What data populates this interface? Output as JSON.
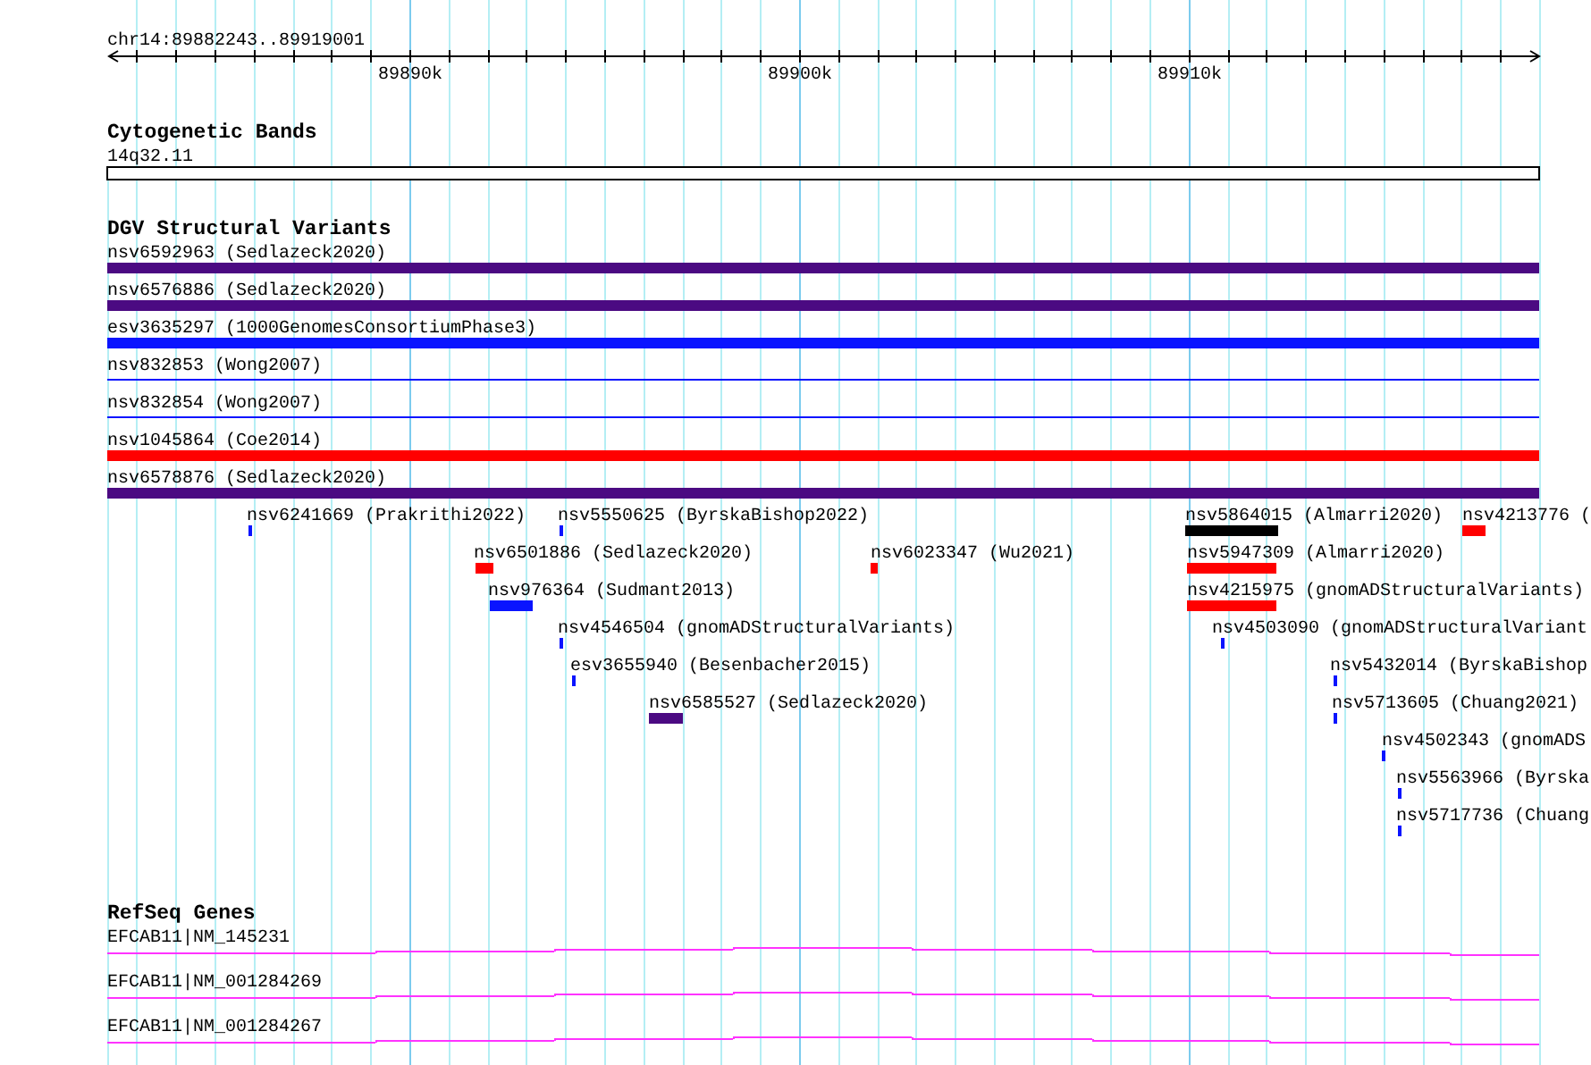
{
  "ruler": {
    "location": "chr14:89882243..89919001",
    "tick_labels": [
      "89890k",
      "89900k",
      "89910k"
    ]
  },
  "cytogenetic_bands": {
    "title": "Cytogenetic Bands",
    "band": "14q32.11"
  },
  "dgv_structural_variants": {
    "title": "DGV Structural Variants",
    "features": [
      {
        "label": "nsv6592963 (Sedlazeck2020)",
        "color": "#4b0a82",
        "kind": "bar"
      },
      {
        "label": "nsv6576886 (Sedlazeck2020)",
        "color": "#4b0a82",
        "kind": "bar"
      },
      {
        "label": "esv3635297 (1000GenomesConsortiumPhase3)",
        "color": "#0a14ff",
        "kind": "bar"
      },
      {
        "label": "nsv832853 (Wong2007)",
        "color": "#0a14ff",
        "kind": "line"
      },
      {
        "label": "nsv832854 (Wong2007)",
        "color": "#0a14ff",
        "kind": "line"
      },
      {
        "label": "nsv1045864 (Coe2014)",
        "color": "#ff0000",
        "kind": "bar"
      },
      {
        "label": "nsv6578876 (Sedlazeck2020)",
        "color": "#4b0a82",
        "kind": "bar"
      },
      {
        "label": "nsv6241669 (Prakrithi2022)",
        "color": "#0a14ff",
        "kind": "bar"
      },
      {
        "label": "nsv5550625 (ByrskaBishop2022)",
        "color": "#0a14ff",
        "kind": "bar"
      },
      {
        "label": "nsv5864015 (Almarri2020)",
        "color": "#000000",
        "kind": "bar"
      },
      {
        "label": "nsv4213776 (",
        "color": "#ff0000",
        "kind": "bar"
      },
      {
        "label": "nsv6501886 (Sedlazeck2020)",
        "color": "#ff0000",
        "kind": "bar"
      },
      {
        "label": "nsv6023347 (Wu2021)",
        "color": "#ff0000",
        "kind": "bar"
      },
      {
        "label": "nsv5947309 (Almarri2020)",
        "color": "#ff0000",
        "kind": "bar"
      },
      {
        "label": "nsv976364 (Sudmant2013)",
        "color": "#0a14ff",
        "kind": "bar"
      },
      {
        "label": "nsv4215975 (gnomADStructuralVariants)",
        "color": "#ff0000",
        "kind": "bar"
      },
      {
        "label": "nsv4546504 (gnomADStructuralVariants)",
        "color": "#0a14ff",
        "kind": "bar"
      },
      {
        "label": "nsv4503090 (gnomADStructuralVariant",
        "color": "#0a14ff",
        "kind": "bar"
      },
      {
        "label": "esv3655940 (Besenbacher2015)",
        "color": "#0a14ff",
        "kind": "bar"
      },
      {
        "label": "nsv5432014 (ByrskaBishop",
        "color": "#0a14ff",
        "kind": "bar"
      },
      {
        "label": "nsv6585527 (Sedlazeck2020)",
        "color": "#4b0a82",
        "kind": "bar"
      },
      {
        "label": "nsv5713605 (Chuang2021)",
        "color": "#0a14ff",
        "kind": "bar"
      },
      {
        "label": "nsv4502343 (gnomADS",
        "color": "#0a14ff",
        "kind": "bar"
      },
      {
        "label": "nsv5563966 (Byrska",
        "color": "#0a14ff",
        "kind": "bar"
      },
      {
        "label": "nsv5717736 (Chuang",
        "color": "#0a14ff",
        "kind": "bar"
      }
    ]
  },
  "refseq_genes": {
    "title": "RefSeq Genes",
    "transcripts": [
      "EFCAB11|NM_145231",
      "EFCAB11|NM_001284269",
      "EFCAB11|NM_001284267"
    ]
  }
}
